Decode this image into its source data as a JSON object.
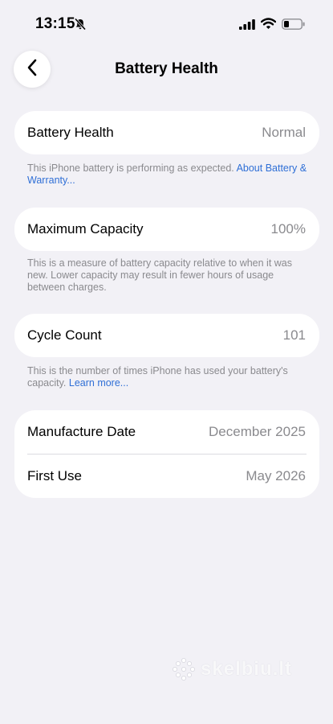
{
  "status_bar": {
    "time": "13:15"
  },
  "header": {
    "title": "Battery Health"
  },
  "battery_health": {
    "label": "Battery Health",
    "value": "Normal",
    "footnote": "This iPhone battery is performing as expected. ",
    "footnote_link": "About Battery & Warranty..."
  },
  "max_capacity": {
    "label": "Maximum Capacity",
    "value": "100%",
    "footnote": "This is a measure of battery capacity relative to when it was new. Lower capacity may result in fewer hours of usage between charges."
  },
  "cycle_count": {
    "label": "Cycle Count",
    "value": "101",
    "footnote": "This is the number of times iPhone has used your battery's capacity. ",
    "footnote_link": "Learn more..."
  },
  "dates": {
    "manufacture_label": "Manufacture Date",
    "manufacture_value": "December 2025",
    "first_use_label": "First Use",
    "first_use_value": "May 2026"
  },
  "watermark": {
    "text": "skelbiu.lt"
  },
  "colors": {
    "background": "#f2f1f6",
    "link": "#2f6fd6",
    "secondary_text": "#8a8a8e"
  }
}
